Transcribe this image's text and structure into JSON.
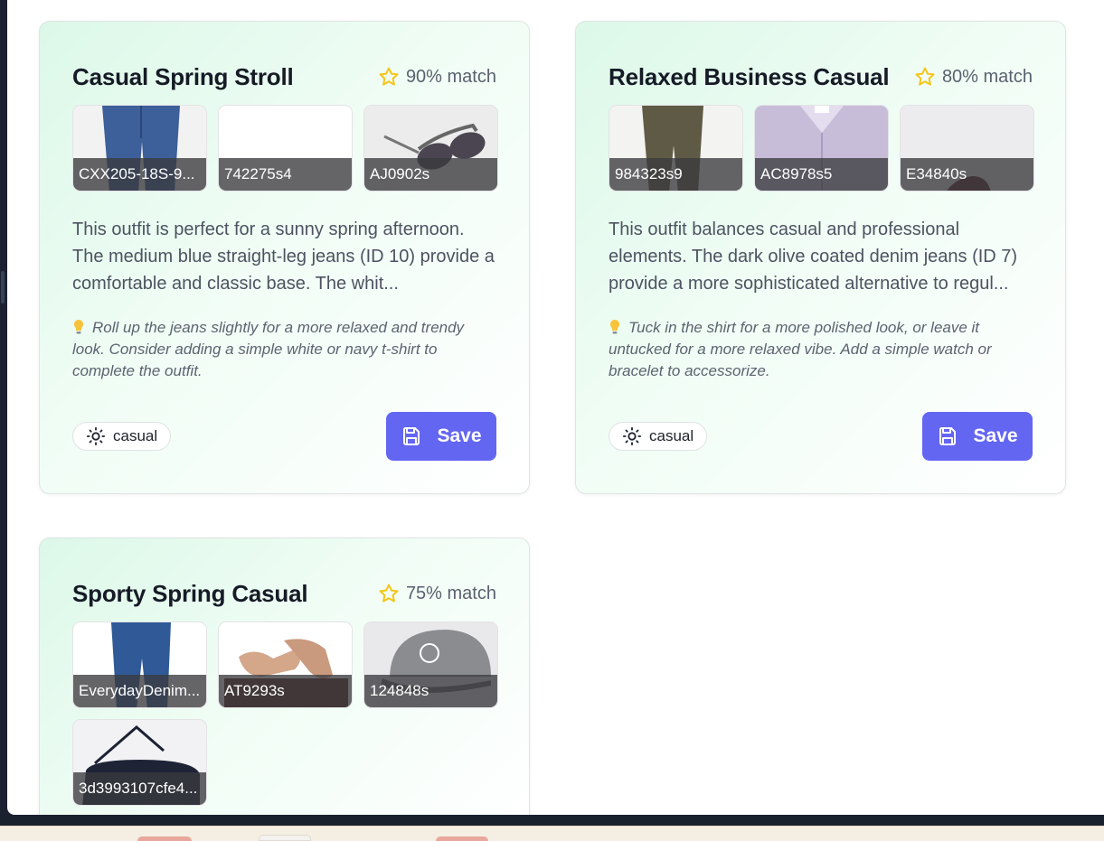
{
  "colors": {
    "accent": "#6366f1",
    "star": "#f5c518",
    "card_gradient_start": "#dcf8e8",
    "card_border": "#dfe5e2"
  },
  "outfits": [
    {
      "title": "Casual Spring Stroll",
      "match": "90% match",
      "items": [
        {
          "label": "CXX205-18S-9...",
          "icon": "jeans-image"
        },
        {
          "label": "742275s4",
          "icon": "blank-image"
        },
        {
          "label": "AJ0902s",
          "icon": "sunglasses-image"
        }
      ],
      "description": "This outfit is perfect for a sunny spring afternoon. The medium blue straight-leg jeans (ID 10) provide a comfortable and classic base. The whit...",
      "tip_icon": "lightbulb-icon",
      "tip": "Roll up the jeans slightly for a more relaxed and trendy look. Consider adding a simple white or navy t-shirt to complete the outfit.",
      "tag": "casual",
      "tag_icon": "sun-icon",
      "save_label": "Save"
    },
    {
      "title": "Relaxed Business Casual",
      "match": "80% match",
      "items": [
        {
          "label": "984323s9",
          "icon": "olive-pants-image"
        },
        {
          "label": "AC8978s5",
          "icon": "lavender-shirt-image"
        },
        {
          "label": "E34840s",
          "icon": "shoe-image"
        }
      ],
      "description": "This outfit balances casual and professional elements. The dark olive coated denim jeans (ID 7) provide a more sophisticated alternative to regul...",
      "tip_icon": "lightbulb-icon",
      "tip": "Tuck in the shirt for a more polished look, or leave it untucked for a more relaxed vibe. Add a simple watch or bracelet to accessorize.",
      "tag": "casual",
      "tag_icon": "sun-icon",
      "save_label": "Save"
    },
    {
      "title": "Sporty Spring Casual",
      "match": "75% match",
      "items": [
        {
          "label": "EverydayDenim...",
          "icon": "jeans-image"
        },
        {
          "label": "AT9293s",
          "icon": "socks-image"
        },
        {
          "label": "124848s",
          "icon": "cap-image"
        },
        {
          "label": "3d3993107cfe4...",
          "icon": "duffel-bag-image"
        }
      ]
    }
  ]
}
